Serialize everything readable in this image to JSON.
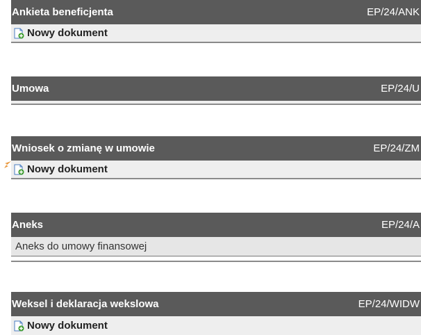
{
  "sections": [
    {
      "title": "Ankieta beneficjenta",
      "code": "EP/24/ANK",
      "new_document_label": "Nowy dokument"
    },
    {
      "title": "Umowa",
      "code": "EP/24/U"
    },
    {
      "title": "Wniosek o zmianę w umowie",
      "code": "EP/24/ZM",
      "new_document_label": "Nowy dokument"
    },
    {
      "title": "Aneks",
      "code": "EP/24/A",
      "item_label": "Aneks do umowy finansowej"
    },
    {
      "title": "Weksel i deklaracja wekslowa",
      "code": "EP/24/WIDW",
      "new_document_label": "Nowy dokument"
    }
  ],
  "colors": {
    "header_bg": "#5a5a5a",
    "body_bg": "#eeeeee",
    "accent_arrow": "#e8963a",
    "icon_green": "#3a9a2a",
    "icon_blue": "#4a7cc0"
  }
}
